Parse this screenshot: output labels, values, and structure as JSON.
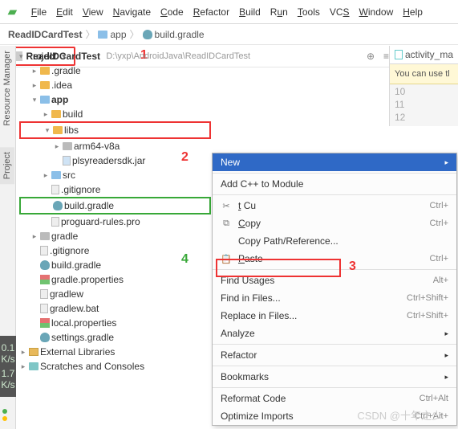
{
  "menu": {
    "file": "File",
    "edit": "Edit",
    "view": "View",
    "navigate": "Navigate",
    "code": "Code",
    "refactor": "Refactor",
    "build": "Build",
    "run": "Run",
    "tools": "Tools",
    "vcs": "VCS",
    "window": "Window",
    "help": "Help"
  },
  "breadcrumb": {
    "a": "ReadIDCardTest",
    "b": "app",
    "c": "build.gradle"
  },
  "project_selector": "Project",
  "right": {
    "tab": "activity_ma",
    "hint": "You can use tl",
    "lines": [
      "10",
      "11",
      "12"
    ]
  },
  "left_tabs": {
    "rm": "Resource Manager",
    "proj": "Project"
  },
  "stats": {
    "a": "0.1",
    "b": "K/s",
    "c": "1.7",
    "d": "K/s"
  },
  "tree": {
    "root": "ReadIDCardTest",
    "root_path": "D:\\yxp\\AndroidJava\\ReadIDCardTest",
    "gradle_dir": ".gradle",
    "idea_dir": ".idea",
    "app": "app",
    "build": "build",
    "libs": "libs",
    "arm": "arm64-v8a",
    "jar": "plsyreadersdk.jar",
    "src": "src",
    "gitignore": ".gitignore",
    "buildgradle": "build.gradle",
    "proguard": "proguard-rules.pro",
    "gradle": "gradle",
    "gitignore2": ".gitignore",
    "buildgradle2": "build.gradle",
    "gradleprops": "gradle.properties",
    "gradlew": "gradlew",
    "gradlewbat": "gradlew.bat",
    "localprops": "local.properties",
    "settings": "settings.gradle",
    "ext": "External Libraries",
    "scratch": "Scratches and Consoles"
  },
  "cm": {
    "new": "New",
    "addcpp": "Add C++ to Module",
    "cut": "Cut",
    "copy": "Copy",
    "copypath": "Copy Path/Reference...",
    "paste": "Paste",
    "find": "Find Usages",
    "findfiles": "Find in Files...",
    "replace": "Replace in Files...",
    "analyze": "Analyze",
    "refactor": "Refactor",
    "bookmarks": "Bookmarks",
    "reformat": "Reformat Code",
    "optimize": "Optimize Imports",
    "k_cut": "Ctrl+",
    "k_copy": "Ctrl+",
    "k_paste": "Ctrl+",
    "k_find": "Alt+",
    "k_findf": "Ctrl+Shift+",
    "k_repl": "Ctrl+Shift+",
    "k_ref": "Ctrl+Alt",
    "k_opt": "Ctrl+Alt+"
  },
  "annot": {
    "a1": "1",
    "a2": "2",
    "a3": "3",
    "a4": "4"
  },
  "watermark": "CSDN @十年之少"
}
